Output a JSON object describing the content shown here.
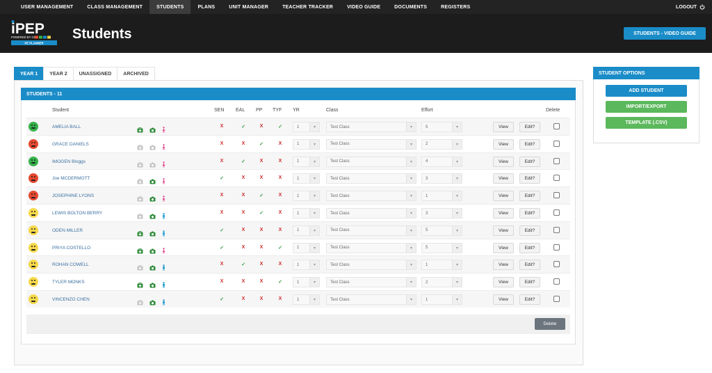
{
  "nav": {
    "items": [
      "USER MANAGEMENT",
      "CLASS MANAGEMENT",
      "STUDENTS",
      "PLANS",
      "UNIT MANAGER",
      "TEACHER TRACKER",
      "VIDEO GUIDE",
      "DOCUMENTS",
      "REGISTERS"
    ],
    "active_index": 2,
    "logout": "LOGOUT"
  },
  "header": {
    "logo_text": "iPEP",
    "logo_sub": "POWERED BY CES",
    "logo_band": "PE PLANNER",
    "title": "Students",
    "video_button": "STUDENTS - VIDEO GUIDE"
  },
  "tabs": [
    "YEAR 1",
    "YEAR 2",
    "UNASSIGNED",
    "ARCHIVED"
  ],
  "active_tab": 0,
  "panel": {
    "title": "STUDENTS - 11"
  },
  "table": {
    "headers": {
      "student": "Student",
      "sen": "SEN",
      "eal": "EAL",
      "pp": "PP",
      "tyf": "TYF",
      "yr": "YR",
      "class": "Class",
      "effort": "Effort",
      "delete": "Delete"
    },
    "view_label": "View",
    "edit_label": "Edit?",
    "rows": [
      {
        "face": "green",
        "name": "AMELIA BALL",
        "icons": [
          "medical-green",
          "camera-green",
          "female"
        ],
        "sen": false,
        "eal": true,
        "pp": false,
        "tyf": true,
        "yr": "1",
        "class": "Test Class",
        "effort": "5"
      },
      {
        "face": "red",
        "name": "GRACE DANIELS",
        "icons": [
          "medical-grey",
          "camera-grey",
          "female"
        ],
        "sen": false,
        "eal": false,
        "pp": true,
        "tyf": false,
        "yr": "1",
        "class": "Test Class",
        "effort": "2"
      },
      {
        "face": "green",
        "name": "IMOGEN Bloggs",
        "icons": [
          "medical-grey",
          "camera-grey",
          "female"
        ],
        "sen": false,
        "eal": true,
        "pp": false,
        "tyf": false,
        "yr": "1",
        "class": "Test Class",
        "effort": "4"
      },
      {
        "face": "red",
        "name": "Joe MCDERMOTT",
        "icons": [
          "medical-grey",
          "camera-green",
          "female"
        ],
        "sen": true,
        "eal": false,
        "pp": false,
        "tyf": false,
        "yr": "1",
        "class": "Test Class",
        "effort": "3"
      },
      {
        "face": "red",
        "name": "JOSEPHINE LYONS",
        "icons": [
          "medical-grey",
          "camera-green",
          "female"
        ],
        "sen": false,
        "eal": false,
        "pp": true,
        "tyf": false,
        "yr": "1",
        "class": "Test Class",
        "effort": "1"
      },
      {
        "face": "yellow",
        "name": "LEWIS BOLTON BERRY",
        "icons": [
          "medical-grey",
          "camera-green",
          "male"
        ],
        "sen": false,
        "eal": false,
        "pp": true,
        "tyf": false,
        "yr": "1",
        "class": "Test Class",
        "effort": "3"
      },
      {
        "face": "yellow",
        "name": "ODEN MILLER",
        "icons": [
          "medical-green",
          "camera-green",
          "male"
        ],
        "sen": true,
        "eal": false,
        "pp": false,
        "tyf": false,
        "yr": "1",
        "class": "Test Class",
        "effort": "5"
      },
      {
        "face": "yellow",
        "name": "PRIYA COSTELLO",
        "icons": [
          "medical-green",
          "camera-green",
          "female"
        ],
        "sen": true,
        "eal": false,
        "pp": false,
        "tyf": true,
        "yr": "1",
        "class": "Test Class",
        "effort": "5"
      },
      {
        "face": "yellow",
        "name": "ROHAN COWELL",
        "icons": [
          "medical-grey",
          "camera-green",
          "male"
        ],
        "sen": false,
        "eal": true,
        "pp": false,
        "tyf": false,
        "yr": "1",
        "class": "Test Class",
        "effort": "1"
      },
      {
        "face": "yellow",
        "name": "TYLER MONKS",
        "icons": [
          "medical-green",
          "camera-green",
          "male"
        ],
        "sen": false,
        "eal": false,
        "pp": false,
        "tyf": true,
        "yr": "1",
        "class": "Test Class",
        "effort": "2"
      },
      {
        "face": "yellow",
        "name": "VINCENZO CHEN",
        "icons": [
          "medical-grey",
          "camera-green",
          "male"
        ],
        "sen": true,
        "eal": false,
        "pp": false,
        "tyf": false,
        "yr": "1",
        "class": "Test Class",
        "effort": "1"
      }
    ],
    "delete_button": "Delete"
  },
  "options": {
    "title": "STUDENT OPTIONS",
    "add_student": "ADD STUDENT",
    "import_export": "IMPORT/EXPORT",
    "template": "TEMPLATE (.CSV)"
  },
  "marks": {
    "yes": "✓",
    "no": "X"
  },
  "colors": {
    "accent": "#1a8cc8",
    "green_button": "#5cb85c",
    "nav_bg": "#232323",
    "header_bg": "#1c1c1c"
  }
}
